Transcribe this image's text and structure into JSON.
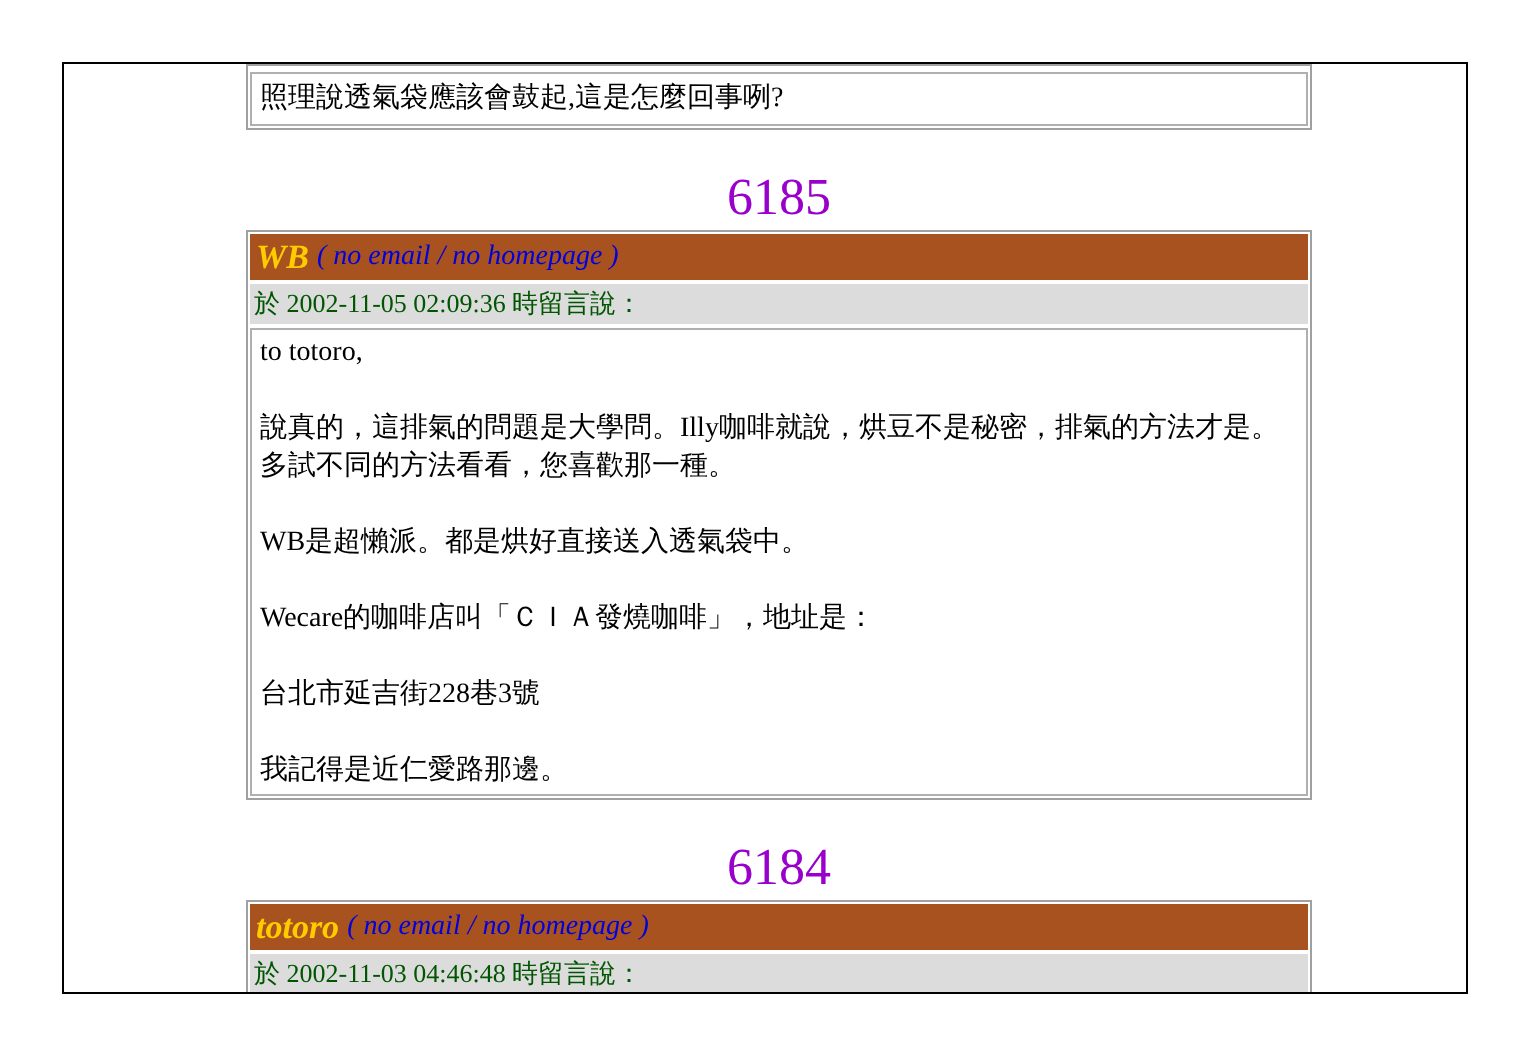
{
  "entries": [
    {
      "body": [
        "照理說透氣袋應該會鼓起,這是怎麼回事咧?"
      ]
    },
    {
      "number": "6185",
      "author": "WB",
      "contact": "( no email / no homepage )",
      "timestamp": "於 2002-11-05 02:09:36 時留言說：",
      "body": [
        "to totoro,",
        "說真的，這排氣的問題是大學問。Illy咖啡就說，烘豆不是秘密，排氣的方法才是。多試不同的方法看看，您喜歡那一種。",
        "WB是超懶派。都是烘好直接送入透氣袋中。",
        "Wecare的咖啡店叫「ＣＩＡ發燒咖啡」，地址是：",
        "台北市延吉街228巷3號",
        "我記得是近仁愛路那邊。"
      ]
    },
    {
      "number": "6184",
      "author": "totoro",
      "contact": "( no email / no homepage )",
      "timestamp": "於 2002-11-03 04:46:48 時留言說："
    }
  ]
}
